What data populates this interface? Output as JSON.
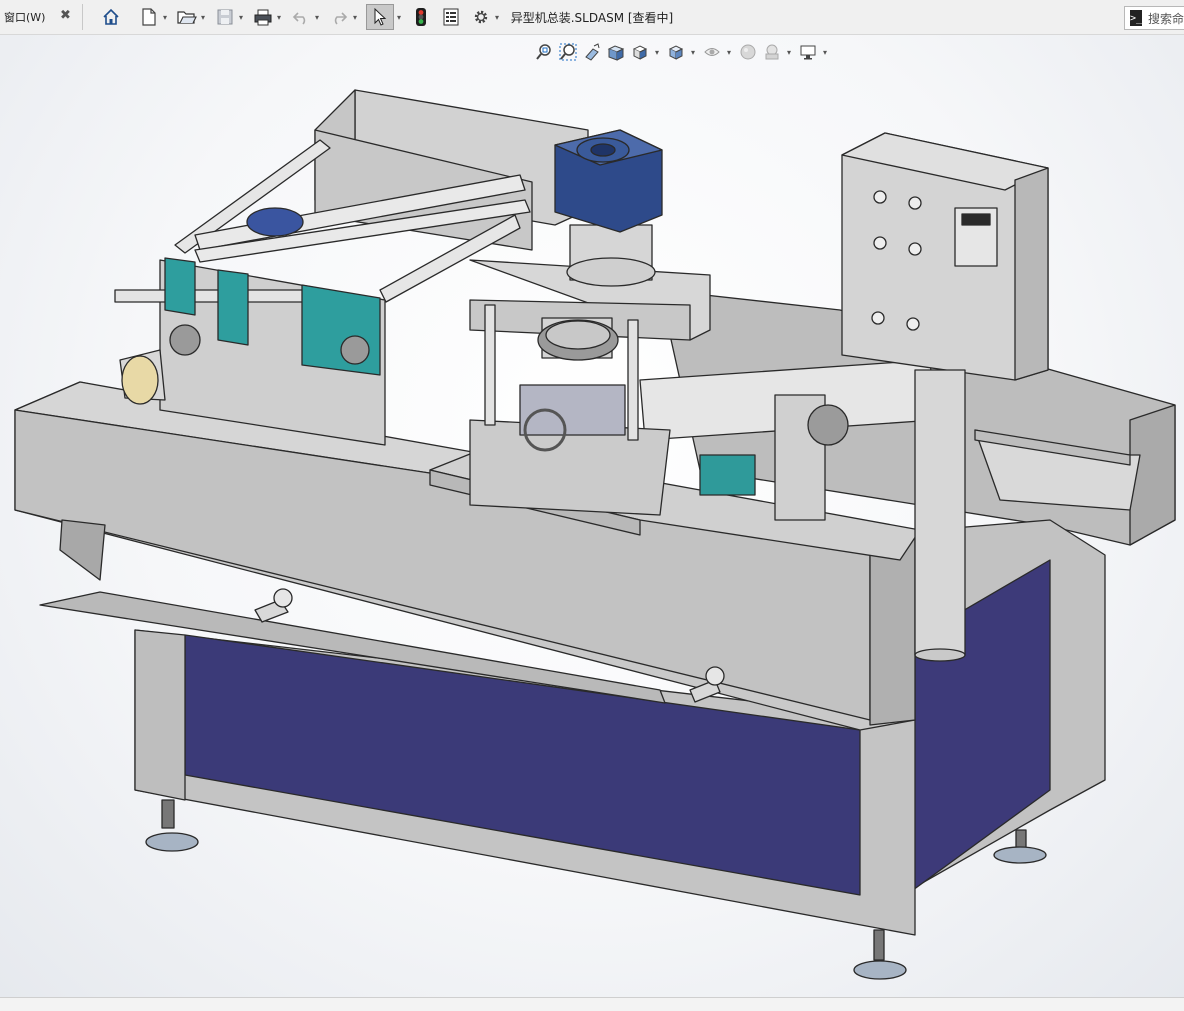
{
  "menu": {
    "window_label": "窗口(W)"
  },
  "document": {
    "title": "异型机总装.SLDASM [查看中]"
  },
  "search": {
    "placeholder": "搜索命令"
  },
  "toolbar": {
    "icons": [
      "home-icon",
      "new-document-icon",
      "open-folder-icon",
      "save-icon",
      "print-icon",
      "undo-icon",
      "redo-icon",
      "select-arrow-icon",
      "rebuild-traffic-light-icon",
      "file-properties-icon",
      "options-gear-icon"
    ]
  },
  "headsup_toolbar": {
    "icons": [
      "zoom-to-fit-icon",
      "zoom-to-area-icon",
      "previous-view-icon",
      "section-view-icon",
      "view-orientation-icon",
      "display-style-icon",
      "hide-show-items-icon",
      "edit-appearance-icon",
      "apply-scene-icon",
      "view-settings-icon"
    ]
  },
  "colors": {
    "frame_gray": "#c4c4c4",
    "panel_blue": "#3b3a78",
    "motor_blue": "#2e4a8a",
    "bearing_teal": "#2e9e9e",
    "edge": "#2a2a2a"
  }
}
